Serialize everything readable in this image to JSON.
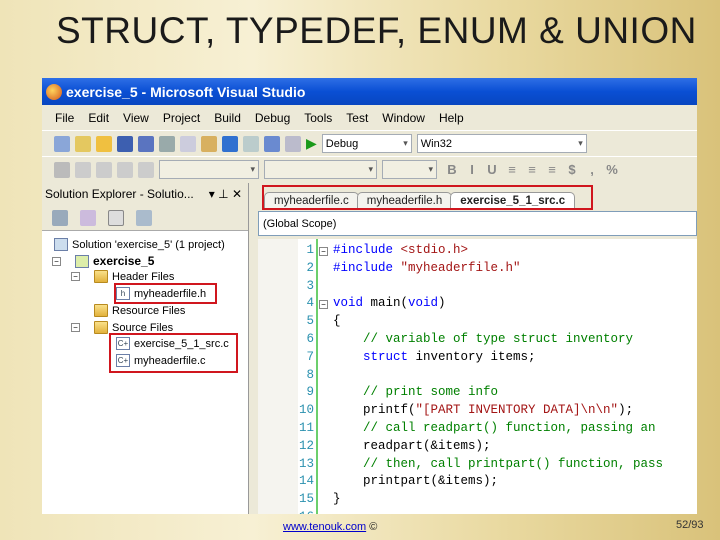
{
  "slide": {
    "title": "STRUCT, TYPEDEF, ENUM & UNION",
    "footer_link": "www.tenouk.com",
    "footer_symbol": "©",
    "page": "52/93"
  },
  "window": {
    "title": "exercise_5 - Microsoft Visual Studio"
  },
  "menu": [
    "File",
    "Edit",
    "View",
    "Project",
    "Build",
    "Debug",
    "Tools",
    "Test",
    "Window",
    "Help"
  ],
  "toolbar": {
    "config": "Debug",
    "platform": "Win32",
    "format_buttons": [
      "B",
      "I",
      "U",
      "≡",
      "≡",
      "≡",
      "$",
      ",",
      "%"
    ]
  },
  "solution_explorer": {
    "title": "Solution Explorer - Solutio...",
    "solution": "Solution 'exercise_5' (1 project)",
    "project": "exercise_5",
    "header_folder": "Header Files",
    "header_file": "myheaderfile.h",
    "resource_folder": "Resource Files",
    "source_folder": "Source Files",
    "source_files": [
      "exercise_5_1_src.c",
      "myheaderfile.c"
    ]
  },
  "editor": {
    "tabs": [
      "myheaderfile.c",
      "myheaderfile.h",
      "exercise_5_1_src.c"
    ],
    "active_tab": "exercise_5_1_src.c",
    "scope": "(Global Scope)",
    "lines": [
      [
        {
          "c": "kw",
          "t": "#include"
        },
        {
          "c": "",
          "t": " "
        },
        {
          "c": "str",
          "t": "<stdio.h>"
        }
      ],
      [
        {
          "c": "kw",
          "t": "#include"
        },
        {
          "c": "",
          "t": " "
        },
        {
          "c": "str",
          "t": "\"myheaderfile.h\""
        }
      ],
      [],
      [
        {
          "c": "kw",
          "t": "void"
        },
        {
          "c": "",
          "t": " main("
        },
        {
          "c": "kw",
          "t": "void"
        },
        {
          "c": "",
          "t": ")"
        }
      ],
      [
        {
          "c": "",
          "t": "{"
        }
      ],
      [
        {
          "c": "cm",
          "t": "    // variable of type struct inventory"
        }
      ],
      [
        {
          "c": "",
          "t": "    "
        },
        {
          "c": "kw",
          "t": "struct"
        },
        {
          "c": "",
          "t": " inventory items;"
        }
      ],
      [],
      [
        {
          "c": "cm",
          "t": "    // print some info"
        }
      ],
      [
        {
          "c": "",
          "t": "    printf("
        },
        {
          "c": "str",
          "t": "\"[PART INVENTORY DATA]\\n\\n\""
        },
        {
          "c": "",
          "t": ");"
        }
      ],
      [
        {
          "c": "cm",
          "t": "    // call readpart() function, passing an"
        }
      ],
      [
        {
          "c": "",
          "t": "    readpart(&items);"
        }
      ],
      [
        {
          "c": "cm",
          "t": "    // then, call printpart() function, pass"
        }
      ],
      [
        {
          "c": "",
          "t": "    printpart(&items);"
        }
      ],
      [
        {
          "c": "",
          "t": "}"
        }
      ],
      []
    ]
  }
}
